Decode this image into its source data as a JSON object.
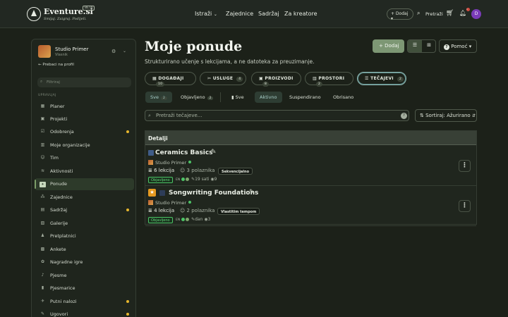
{
  "header": {
    "brand": "Eventure.si",
    "tagline": "Smijaj. Zaigraj. Podijeli.",
    "beta": "BETA",
    "nav": [
      "Istraži",
      "Zajednice",
      "Sadržaj",
      "Za kreatore"
    ],
    "nav_dropdown_icon": "chevron-down-icon",
    "add_label": "+ Dodaj",
    "search_label": "Pretraži",
    "notif_count": "1",
    "avatar_letter": "D"
  },
  "sidebar": {
    "studio_name": "Studio Primer",
    "studio_role": "Vlasnik",
    "back_label": "Prebaci na profil",
    "search_placeholder": "Filtriraj",
    "section_label": "UPRAVLJAJ",
    "items": [
      {
        "label": "Planer",
        "icon": "calendar-icon",
        "dot": false
      },
      {
        "label": "Projekti",
        "icon": "folder-icon",
        "dot": false
      },
      {
        "label": "Odobrenja",
        "icon": "check-icon",
        "dot": true
      },
      {
        "label": "Moje organizacije",
        "icon": "building-icon",
        "dot": false
      },
      {
        "label": "Tim",
        "icon": "users-icon",
        "dot": false
      },
      {
        "label": "Aktivnosti",
        "icon": "activity-icon",
        "dot": false
      },
      {
        "label": "Ponude",
        "icon": "tag-icon",
        "dot": false,
        "active": true
      },
      {
        "label": "Zajednice",
        "icon": "community-icon",
        "dot": false
      },
      {
        "label": "Sadržaj",
        "icon": "content-icon",
        "dot": true
      },
      {
        "label": "Galerije",
        "icon": "image-icon",
        "dot": false
      },
      {
        "label": "Pretplatnici",
        "icon": "subscribers-icon",
        "dot": false
      },
      {
        "label": "Ankete",
        "icon": "poll-icon",
        "dot": false
      },
      {
        "label": "Nagradne igre",
        "icon": "gift-icon",
        "dot": false
      },
      {
        "label": "Pjesme",
        "icon": "music-icon",
        "dot": false
      },
      {
        "label": "Pjesmarice",
        "icon": "book-icon",
        "dot": false
      },
      {
        "label": "Putni nalozi",
        "icon": "travel-icon",
        "dot": true
      },
      {
        "label": "Ugovori",
        "icon": "contract-icon",
        "dot": true
      }
    ]
  },
  "main": {
    "title": "Moje ponude",
    "subtitle": "Strukturirano učenje s lekcijama, a ne datoteka za preuzimanje.",
    "add_button": "Dodaj",
    "help_button": "Pomoć",
    "categories": [
      {
        "label": "DOGAĐAJI",
        "count": "10"
      },
      {
        "label": "USLUGE",
        "count": "4"
      },
      {
        "label": "PROIZVODI",
        "count": "8"
      },
      {
        "label": "PROSTORI",
        "count": "2"
      },
      {
        "label": "TEČAJEVI",
        "count": "2",
        "active": true
      }
    ],
    "filters_a": [
      {
        "label": "Sve",
        "count": "2",
        "selected": true
      },
      {
        "label": "Objavljeno",
        "count": "2"
      }
    ],
    "filters_b": [
      {
        "label": "Sve"
      },
      {
        "label": "Aktivno",
        "selected": true
      },
      {
        "label": "Suspendirano"
      },
      {
        "label": "Obrisano"
      }
    ],
    "search_placeholder": "Pretraži tečajeve...",
    "sort_label": "Sortiraj: Ažurirano",
    "table_header": "Detalji",
    "rows": [
      {
        "title": "Ceramics Basics",
        "owner": "Studio Primer",
        "lessons": "6 lekcija",
        "participants": "3 polaznika",
        "mode": "Sekvencijalno",
        "status": "Objavljeno",
        "lang": "EN",
        "duration": "19 sati",
        "views": "9"
      },
      {
        "title": "Songwriting Foundations",
        "owner": "Studio Primer",
        "lessons": "4 lekcija",
        "participants": "2 polaznika",
        "mode": "Vlastitim tempom",
        "status": "Objavljeno",
        "lang": "EN",
        "duration": "dan",
        "views": "3"
      }
    ]
  }
}
